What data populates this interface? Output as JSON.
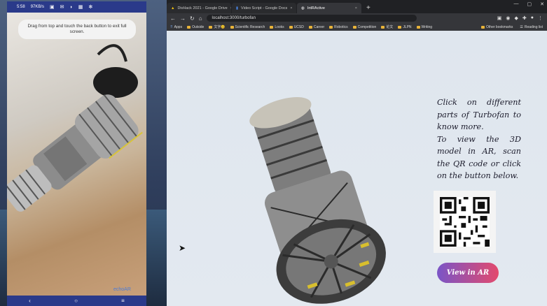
{
  "phone": {
    "status_time": "5:58",
    "status_rate": "97KB/s",
    "status_icons": [
      "video-icon",
      "message-icon",
      "headset-icon",
      "image-icon",
      "square-icon",
      "gear-icon"
    ],
    "toast": "Drag from top and touch the back button to exit full screen.",
    "brand": "echoAR",
    "nav_icons": [
      "back-icon",
      "home-icon",
      "recents-icon"
    ]
  },
  "browser": {
    "tabs": [
      {
        "label": "DivHack 2021 - Google Drive",
        "active": false
      },
      {
        "label": "Video Script - Google Docs",
        "active": false
      },
      {
        "label": "IntRActive",
        "active": true
      }
    ],
    "new_tab_label": "+",
    "url": "localhost:3000/turbofan",
    "bookmarks": [
      {
        "label": "Apps",
        "type": "apps"
      },
      {
        "label": "Outside",
        "type": "folder"
      },
      {
        "label": "文字🥴",
        "type": "folder"
      },
      {
        "label": "Scientific Research",
        "type": "folder"
      },
      {
        "label": "Looks",
        "type": "folder"
      },
      {
        "label": "UCSD",
        "type": "folder"
      },
      {
        "label": "Career",
        "type": "folder"
      },
      {
        "label": "Robotics",
        "type": "folder"
      },
      {
        "label": "Competition",
        "type": "folder"
      },
      {
        "label": "论文",
        "type": "folder"
      },
      {
        "label": "JLPN",
        "type": "folder"
      },
      {
        "label": "Writing",
        "type": "folder"
      }
    ],
    "other_bookmarks": "Other bookmarks",
    "reading_list": "Reading list"
  },
  "page": {
    "instructions_1": "Click on different parts of Turbofan to know more.",
    "instructions_2": "To view the 3D model in AR, scan the QR code or click on the button below.",
    "ar_button": "View in AR"
  },
  "colors": {
    "button_gradient_start": "#7a55c7",
    "button_gradient_end": "#e34a6d",
    "phone_bar": "#2a3a8a",
    "page_bg": "#dfe6ee"
  }
}
